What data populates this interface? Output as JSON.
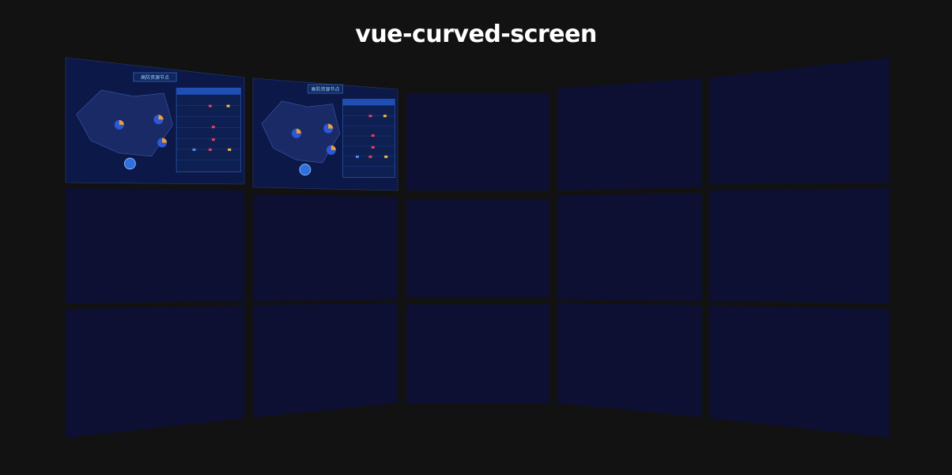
{
  "page": {
    "title": "vue-curved-screen"
  },
  "wall": {
    "rows": 3,
    "cols": 5,
    "panel_color": "#0d1033",
    "background": "#121212",
    "dashboard_thumbnails": [
      {
        "row": 0,
        "col": 0,
        "heading": "高防资源节点"
      },
      {
        "row": 0,
        "col": 1,
        "heading": "高防资源节点"
      }
    ]
  }
}
